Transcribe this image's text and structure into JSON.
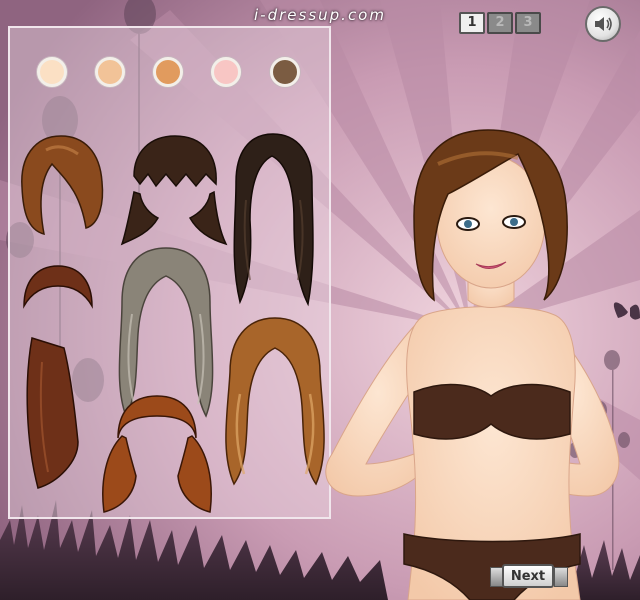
{
  "header": {
    "site_title": "i-dressup.com"
  },
  "steps": [
    {
      "label": "1",
      "active": true
    },
    {
      "label": "2",
      "active": false
    },
    {
      "label": "3",
      "active": false
    }
  ],
  "sound_button": {
    "icon": "speaker-icon"
  },
  "skin_tones": [
    "#fbe0c4",
    "#f2c398",
    "#e19b5e",
    "#f8c6c4",
    "#7b5c42"
  ],
  "hairstyles": [
    {
      "name": "auburn-bob",
      "color": "#8a4a1e"
    },
    {
      "name": "dark-bangs-layered",
      "color": "#3a2418"
    },
    {
      "name": "dark-long-wavy",
      "color": "#2e2018"
    },
    {
      "name": "red-brown-long-straight",
      "color": "#6e3018"
    },
    {
      "name": "ash-long-wavy",
      "color": "#8a8478"
    },
    {
      "name": "caramel-long-wavy",
      "color": "#a8652a"
    },
    {
      "name": "copper-pigtails",
      "color": "#9c4a1a"
    }
  ],
  "next_button": {
    "label": "Next"
  }
}
